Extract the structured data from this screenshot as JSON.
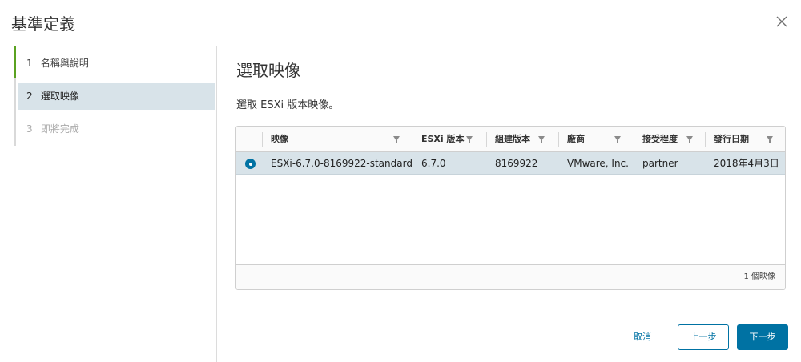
{
  "dialog": {
    "title": "基準定義",
    "close_icon": "close-icon"
  },
  "steps": [
    {
      "num": "1",
      "label": "名稱與說明",
      "state": "completed"
    },
    {
      "num": "2",
      "label": "選取映像",
      "state": "active"
    },
    {
      "num": "3",
      "label": "即將完成",
      "state": "disabled"
    }
  ],
  "main": {
    "title": "選取映像",
    "subtitle": "選取 ESXi 版本映像。"
  },
  "grid": {
    "columns": [
      "映像",
      "ESXi 版本",
      "組建版本",
      "廠商",
      "接受程度",
      "發行日期"
    ],
    "rows": [
      {
        "selected": true,
        "cells": [
          "ESXi-6.7.0-8169922-standard",
          "6.7.0",
          "8169922",
          "VMware, Inc.",
          "partner",
          "2018年4月3日"
        ]
      }
    ],
    "footer_count": "1 個映像"
  },
  "buttons": {
    "cancel": "取消",
    "back": "上一步",
    "next": "下一步"
  },
  "colors": {
    "accent": "#0072a3",
    "completed": "#5aa220",
    "selected_row": "#d8e3e9"
  }
}
